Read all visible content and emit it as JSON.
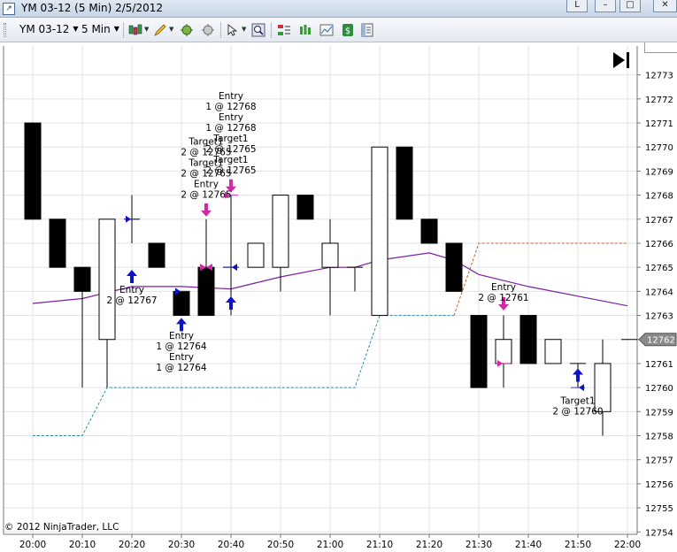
{
  "window": {
    "title": "YM 03-12 (5 Min)  2/5/2012",
    "restore_label": "L",
    "minimize_label": "–",
    "maximize_label": "□",
    "close_label": "✕"
  },
  "toolbar": {
    "instrument": "YM 03-12",
    "interval": "5 Min",
    "icons": [
      "bar-style-icon",
      "draw-pencil-icon",
      "add-indicator-icon",
      "strategy-icon",
      "pointer-icon",
      "zoom-icon",
      "orders-panel-icon",
      "chart-trader-icon",
      "data-box-icon",
      "price-marker-icon",
      "properties-icon"
    ]
  },
  "footer": {
    "copyright": "© 2012 NinjaTrader, LLC"
  },
  "colors": {
    "indicator": "#7b1fa2",
    "target": "#d12aa8",
    "buy": "#0b12c8",
    "stop": "#2a8db0",
    "profit": "#c06030"
  },
  "chart_data": {
    "type": "candlestick",
    "instrument": "YM 03-12",
    "interval": "5 Min",
    "x_ticks": [
      "20:00",
      "20:10",
      "20:20",
      "20:30",
      "20:40",
      "20:50",
      "21:00",
      "21:10",
      "21:20",
      "21:30",
      "21:40",
      "21:50",
      "22:00"
    ],
    "y_ticks": [
      12773,
      12772,
      12771,
      12770,
      12769,
      12768,
      12767,
      12766,
      12765,
      12764,
      12763,
      12762,
      12761,
      12760,
      12759,
      12758,
      12757,
      12756,
      12755,
      12754
    ],
    "ylim": [
      12753.9,
      12774.2
    ],
    "last_price": 12762,
    "candles": [
      {
        "time": "20:00",
        "open": 12771,
        "high": 12771,
        "low": 12767,
        "close": 12767
      },
      {
        "time": "20:05",
        "open": 12767,
        "high": 12767,
        "low": 12765,
        "close": 12765
      },
      {
        "time": "20:10",
        "open": 12765,
        "high": 12765,
        "low": 12760,
        "close": 12764
      },
      {
        "time": "20:15",
        "open": 12762,
        "high": 12767,
        "low": 12760,
        "close": 12767
      },
      {
        "time": "20:20",
        "open": 12767,
        "high": 12768,
        "low": 12766,
        "close": 12767
      },
      {
        "time": "20:25",
        "open": 12766,
        "high": 12766,
        "low": 12765,
        "close": 12765
      },
      {
        "time": "20:30",
        "open": 12764,
        "high": 12764,
        "low": 12763,
        "close": 12763
      },
      {
        "time": "20:35",
        "open": 12765,
        "high": 12767,
        "low": 12763,
        "close": 12763
      },
      {
        "time": "20:40",
        "open": 12765,
        "high": 12768,
        "low": 12763,
        "close": 12765
      },
      {
        "time": "20:45",
        "open": 12765,
        "high": 12766,
        "low": 12765,
        "close": 12766
      },
      {
        "time": "20:50",
        "open": 12765,
        "high": 12768,
        "low": 12764,
        "close": 12768
      },
      {
        "time": "20:55",
        "open": 12768,
        "high": 12768,
        "low": 12767,
        "close": 12767
      },
      {
        "time": "21:00",
        "open": 12765,
        "high": 12767,
        "low": 12763,
        "close": 12766
      },
      {
        "time": "21:05",
        "open": 12765,
        "high": 12765,
        "low": 12764,
        "close": 12765
      },
      {
        "time": "21:10",
        "open": 12763,
        "high": 12770,
        "low": 12763,
        "close": 12770
      },
      {
        "time": "21:15",
        "open": 12770,
        "high": 12770,
        "low": 12767,
        "close": 12767
      },
      {
        "time": "21:20",
        "open": 12767,
        "high": 12767,
        "low": 12766,
        "close": 12766
      },
      {
        "time": "21:25",
        "open": 12766,
        "high": 12766,
        "low": 12764,
        "close": 12764
      },
      {
        "time": "21:30",
        "open": 12763,
        "high": 12763,
        "low": 12760,
        "close": 12760
      },
      {
        "time": "21:35",
        "open": 12761,
        "high": 12763,
        "low": 12760,
        "close": 12762
      },
      {
        "time": "21:40",
        "open": 12763,
        "high": 12763,
        "low": 12761,
        "close": 12761
      },
      {
        "time": "21:45",
        "open": 12761,
        "high": 12762,
        "low": 12761,
        "close": 12762
      },
      {
        "time": "21:50",
        "open": 12761,
        "high": 12761,
        "low": 12760,
        "close": 12761
      },
      {
        "time": "21:55",
        "open": 12759,
        "high": 12762,
        "low": 12758,
        "close": 12761
      }
    ],
    "indicator_line": [
      {
        "time": "20:00",
        "value": 12763.5
      },
      {
        "time": "20:10",
        "value": 12763.7
      },
      {
        "time": "20:20",
        "value": 12764.2
      },
      {
        "time": "20:30",
        "value": 12764.2
      },
      {
        "time": "20:40",
        "value": 12764.1
      },
      {
        "time": "20:50",
        "value": 12764.6
      },
      {
        "time": "21:00",
        "value": 12765.0
      },
      {
        "time": "21:05",
        "value": 12765.0
      },
      {
        "time": "21:10",
        "value": 12765.3
      },
      {
        "time": "21:20",
        "value": 12765.6
      },
      {
        "time": "21:25",
        "value": 12765.3
      },
      {
        "time": "21:30",
        "value": 12764.7
      },
      {
        "time": "21:40",
        "value": 12764.2
      },
      {
        "time": "21:50",
        "value": 12763.8
      },
      {
        "time": "22:00",
        "value": 12763.4
      }
    ],
    "stop_line": [
      {
        "time": "20:00",
        "value": 12758
      },
      {
        "time": "20:10",
        "value": 12758
      },
      {
        "time": "20:15",
        "value": 12760
      },
      {
        "time": "21:05",
        "value": 12760
      },
      {
        "time": "21:10",
        "value": 12763
      },
      {
        "time": "21:25",
        "value": 12763
      }
    ],
    "target_line": [
      {
        "time": "21:25",
        "value": 12763
      },
      {
        "time": "21:30",
        "value": 12766
      },
      {
        "time": "22:00",
        "value": 12766
      }
    ],
    "annotations": [
      {
        "time": "20:20",
        "lines": [
          "Entry",
          "2 @ 12767"
        ],
        "position": "below",
        "price": 12764.3
      },
      {
        "time": "20:30",
        "lines": [
          "Entry",
          "1 @ 12764",
          "Entry",
          "1 @ 12764"
        ],
        "position": "below",
        "price": 12762.4
      },
      {
        "time": "20:35",
        "lines": [
          "Target1",
          "2 @ 12765",
          "Target1",
          "2 @ 12765",
          "Entry",
          "2 @ 12765"
        ],
        "position": "above",
        "price": 12767.9
      },
      {
        "time": "20:40",
        "lines": [
          "Entry",
          "1 @ 12768",
          "Entry",
          "1 @ 12768",
          "Target1",
          "2 @ 12765",
          "Target1",
          "2 @ 12765"
        ],
        "position": "above",
        "price": 12768.9
      },
      {
        "time": "21:35",
        "lines": [
          "Entry",
          "2 @ 12761"
        ],
        "position": "above",
        "price": 12763.6
      },
      {
        "time": "21:50",
        "lines": [
          "Target1",
          "2 @ 12760"
        ],
        "position": "below",
        "price": 12759.7
      }
    ],
    "markers": [
      {
        "time": "20:20",
        "price": 12764.6,
        "shape": "up-arrow",
        "color": "buy"
      },
      {
        "time": "20:30",
        "price": 12762.6,
        "shape": "up-arrow",
        "color": "buy"
      },
      {
        "time": "20:35",
        "price": 12767.4,
        "shape": "down-arrow",
        "color": "target"
      },
      {
        "time": "20:40",
        "price": 12768.4,
        "shape": "down-arrow",
        "color": "target"
      },
      {
        "time": "20:40",
        "price": 12763.5,
        "shape": "up-arrow",
        "color": "buy"
      },
      {
        "time": "21:35",
        "price": 12763.5,
        "shape": "down-arrow",
        "color": "target"
      },
      {
        "time": "21:50",
        "price": 12760.5,
        "shape": "up-arrow",
        "color": "buy"
      },
      {
        "time": "20:20",
        "price": 12767,
        "shape": "right-tick",
        "color": "buy"
      },
      {
        "time": "20:30",
        "price": 12764,
        "shape": "right-tick",
        "color": "buy"
      },
      {
        "time": "20:35",
        "price": 12765,
        "shape": "bowtie",
        "color": "target"
      },
      {
        "time": "20:40",
        "price": 12768,
        "shape": "right-tick",
        "color": "target"
      },
      {
        "time": "20:40",
        "price": 12765,
        "shape": "left-tick",
        "color": "buy"
      },
      {
        "time": "21:35",
        "price": 12761,
        "shape": "right-tick",
        "color": "target"
      },
      {
        "time": "21:50",
        "price": 12760,
        "shape": "left-tick",
        "color": "buy"
      }
    ]
  }
}
